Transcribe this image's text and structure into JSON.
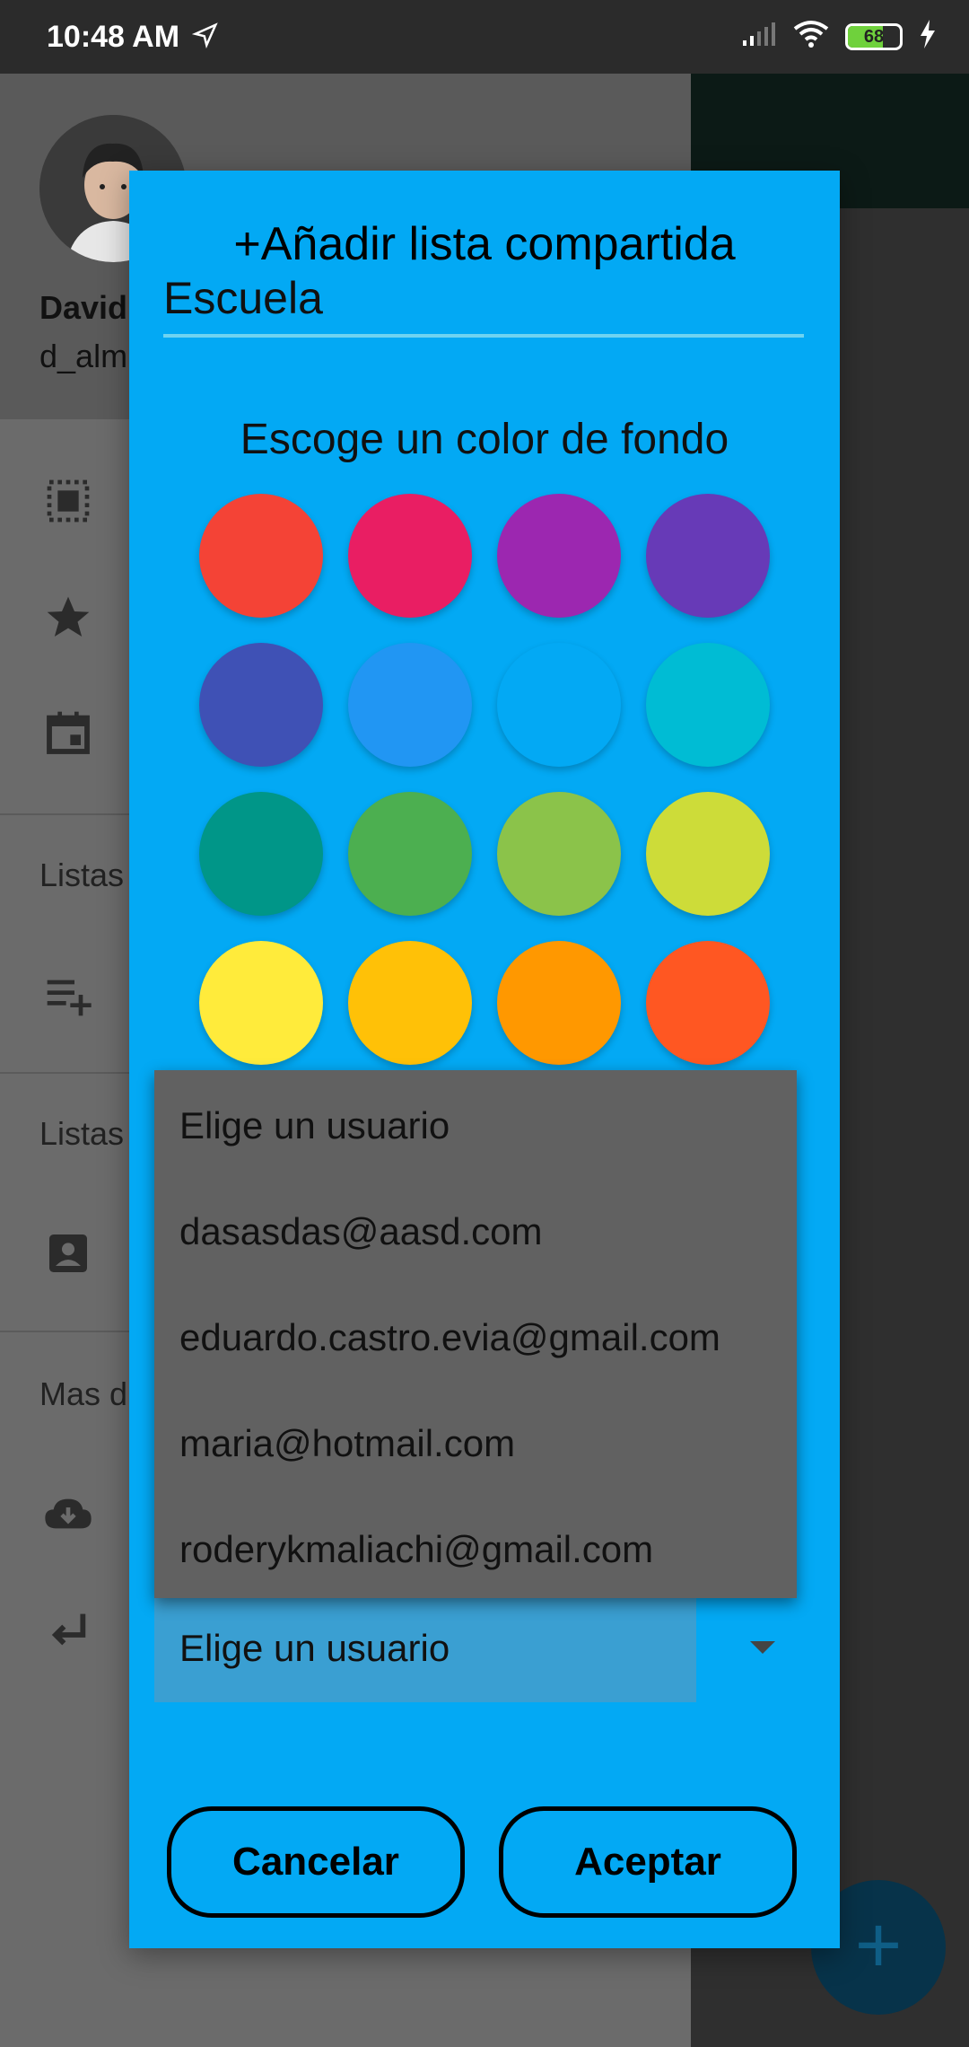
{
  "status_bar": {
    "time": "10:48 AM",
    "battery_level": "68",
    "battery_fraction": 0.68
  },
  "drawer": {
    "user_name": "David",
    "user_email": "d_alm",
    "section_lists_own": "Listas",
    "section_lists_shared": "Listas",
    "section_more": "Mas d",
    "icons": [
      "select-all-icon",
      "star-icon",
      "calendar-icon",
      "playlist-add-icon",
      "contact-icon",
      "cloud-download-icon",
      "return-icon"
    ]
  },
  "dialog": {
    "title": "+Añadir lista compartida",
    "list_name_value": "Escuela",
    "color_heading": "Escoge un color de fondo",
    "colors": [
      "#f44336",
      "#e91e63",
      "#9c27b0",
      "#673ab7",
      "#3f51b5",
      "#2196f3",
      "#03a9f4",
      "#00bcd4",
      "#009688",
      "#4caf50",
      "#8bc34a",
      "#cddc39",
      "#ffeb3b",
      "#ffc107",
      "#ff9800",
      "#ff5722"
    ],
    "user_select_value": "Elige un usuario",
    "dropdown_options": [
      "Elige un usuario",
      "dasasdas@aasd.com",
      "eduardo.castro.evia@gmail.com",
      "maria@hotmail.com",
      "roderykmaliachi@gmail.com"
    ],
    "cancel_label": "Cancelar",
    "accept_label": "Aceptar"
  },
  "fab_label": "+"
}
